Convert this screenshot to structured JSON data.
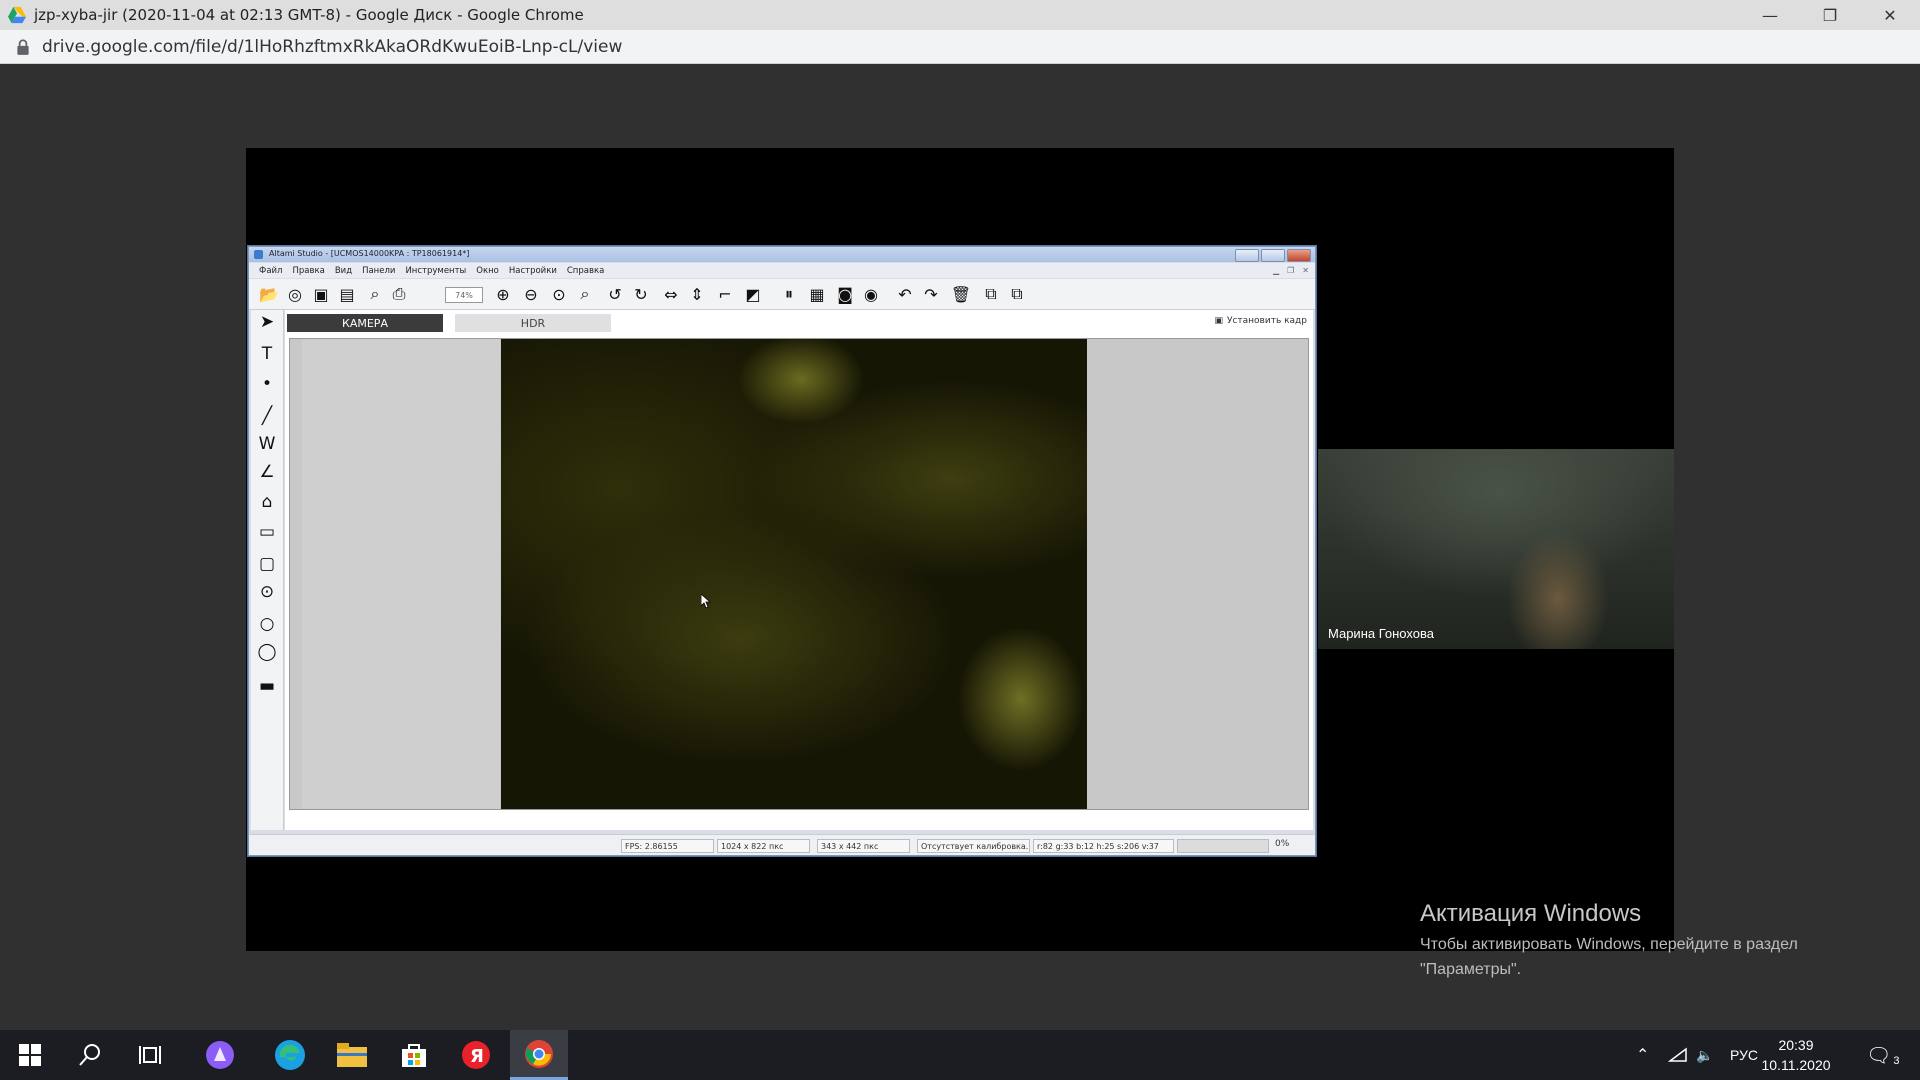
{
  "chrome": {
    "title": "jzp-xyba-jir (2020-11-04 at 02:13 GMT-8) - Google Диск - Google Chrome",
    "url": "drive.google.com/file/d/1lHoRhzftmxRkAkaORdKwuEoiB-Lnp-cL/view",
    "window_buttons": [
      "—",
      "❐",
      "✕"
    ]
  },
  "altami": {
    "title": "Altami Studio - [UCMOS14000KPA : TP18061914*]",
    "menu": [
      "Файл",
      "Правка",
      "Вид",
      "Панели",
      "Инструменты",
      "Окно",
      "Настройки",
      "Справка"
    ],
    "zoom_value": "74%",
    "tabs": {
      "camera": "КАМЕРА",
      "hdr": "HDR"
    },
    "set_frame_label": "Установить кадр",
    "status": {
      "fps": "FPS: 2.86155",
      "resolution": "1024 x 822 пкс",
      "position": "343 x 442 пкс",
      "calibration": "Отсутствует калибровка.",
      "color": "r:82 g:33 b:12 h:25 s:206 v:37",
      "percent": "0%"
    }
  },
  "participant": {
    "name": "Марина Гонохова"
  },
  "activation": {
    "title": "Активация Windows",
    "line1": "Чтобы активировать Windows, перейдите в раздел",
    "line2": "\"Параметры\"."
  },
  "taskbar": {
    "language": "РУС",
    "time": "20:39",
    "date": "10.11.2020",
    "notifications": "3",
    "apps": [
      "start-icon",
      "search-icon",
      "task-view-icon",
      "alice-icon",
      "edge-icon",
      "file-explorer-icon",
      "store-icon",
      "yandex-browser-icon",
      "chrome-icon"
    ]
  }
}
